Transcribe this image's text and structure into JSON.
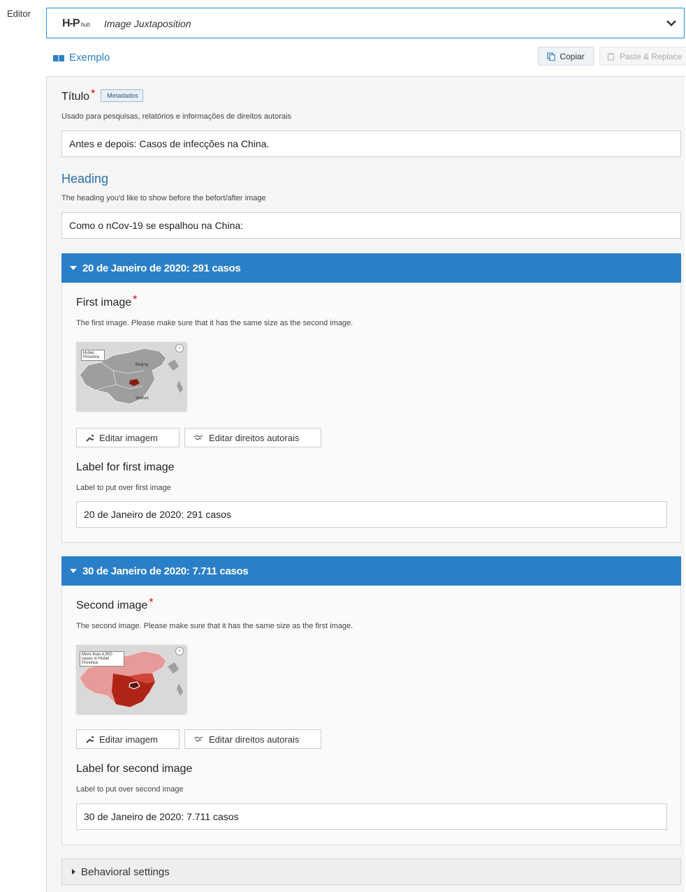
{
  "editor_label": "Editor",
  "library": {
    "logo": "H-P",
    "logo_sub": "hub",
    "title": "Image Juxtaposition"
  },
  "toolbar": {
    "example_label": "Exemplo",
    "copy_label": "Copiar",
    "paste_label": "Paste & Replace"
  },
  "title_field": {
    "label": "Título",
    "meta_tag": "Metadados",
    "description": "Usado para pesquisas, relatórios e informações de direitos autorais",
    "value": "Antes e depois: Casos de infecções na China."
  },
  "heading_field": {
    "label": "Heading",
    "description": "The heading you'd like to show before the befort/after image",
    "value": "Como o nCov-19 se espalhou na China:"
  },
  "group1": {
    "header": "20 de Janeiro de 2020: 291 casos",
    "image_label": "First image",
    "image_description": "The first image. Please make sure that it has the same size as the second image.",
    "map_text": {
      "box": "Hubei Province",
      "city1": "Beijing",
      "city2": "Wuhan"
    },
    "edit_image_label": "Editar imagem",
    "edit_copyright_label": "Editar direitos autorais",
    "label_field_label": "Label for first image",
    "label_field_description": "Label to put over first image",
    "label_field_value": "20 de Janeiro de 2020: 291 casos"
  },
  "group2": {
    "header": "30 de Janeiro de 2020: 7.711 casos",
    "image_label": "Second image",
    "image_description": "The second image. Please make sure that it has the same size as the first image.",
    "map_text": {
      "box": "More than 4,500 cases in Hubei Province"
    },
    "edit_image_label": "Editar imagem",
    "edit_copyright_label": "Editar direitos autorais",
    "label_field_label": "Label for second image",
    "label_field_description": "Label to put over second image",
    "label_field_value": "30 de Janeiro de 2020: 7.711 casos"
  },
  "behavioral": {
    "label": "Behavioral settings"
  },
  "colors": {
    "accent": "#2a7fc9",
    "link": "#2c80c5",
    "required": "#dd0000"
  }
}
